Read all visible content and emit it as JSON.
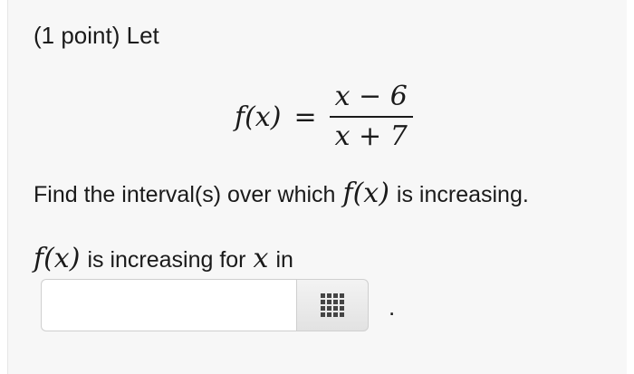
{
  "problem": {
    "header": "(1 point) Let",
    "function": {
      "lhs": "f(x)",
      "equals": "=",
      "numerator": "x − 6",
      "denominator": "x + 7"
    },
    "question": {
      "text_before": "Find the interval(s) over which",
      "fx": "f(x)",
      "text_after": "is increasing."
    },
    "answer_prompt": {
      "fx": "f(x)",
      "text_middle": "is increasing for",
      "x": "x",
      "text_after": "in"
    },
    "answer_field": {
      "value": "",
      "placeholder": ""
    },
    "palette_icon": "grid-keypad-icon",
    "trailing_period": "."
  }
}
